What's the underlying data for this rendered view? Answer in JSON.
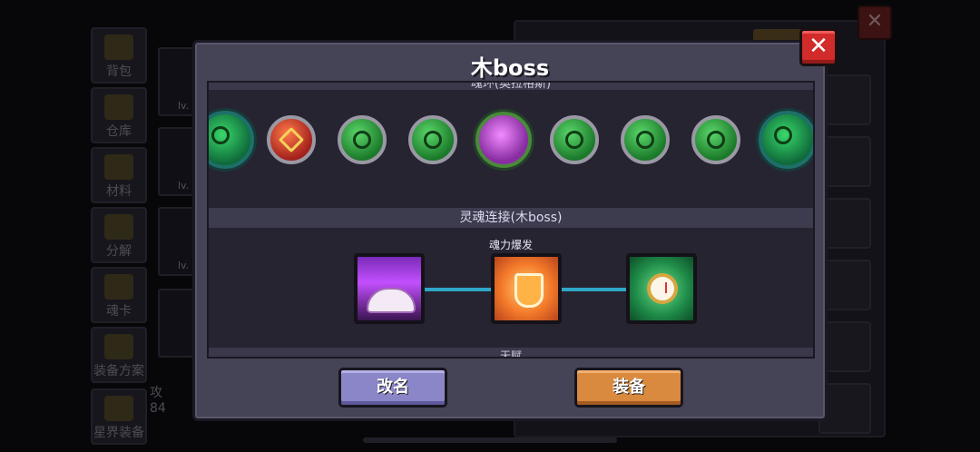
{
  "background": {
    "sidebar_items": [
      {
        "label": "背包",
        "icon": "backpack-icon"
      },
      {
        "label": "仓库",
        "icon": "warehouse-icon"
      },
      {
        "label": "材料",
        "icon": "materials-icon"
      },
      {
        "label": "分解",
        "icon": "disassemble-icon"
      },
      {
        "label": "魂卡",
        "icon": "soul-card-icon"
      },
      {
        "label": "装备方案",
        "icon": "equipment-plan-icon"
      },
      {
        "label": "星界装备",
        "icon": "astral-equipment-icon"
      }
    ],
    "card_levels": [
      "lv.",
      "lv.",
      "lv."
    ],
    "attack_label": "攻",
    "attack_value": "84"
  },
  "dialog": {
    "title": "木boss",
    "close_label": "✕",
    "top_section_partial": "魂环(奥拉格斯)",
    "souls": [
      {
        "name": "boss-soul-1",
        "kind": "boss"
      },
      {
        "name": "red-dagger-soul",
        "kind": "red"
      },
      {
        "name": "green-soul-1",
        "kind": "green"
      },
      {
        "name": "green-soul-2",
        "kind": "green"
      },
      {
        "name": "purple-orb-soul",
        "kind": "purple"
      },
      {
        "name": "green-soul-3",
        "kind": "green"
      },
      {
        "name": "green-soul-4",
        "kind": "green"
      },
      {
        "name": "green-soul-5",
        "kind": "green"
      },
      {
        "name": "boss-soul-2",
        "kind": "boss"
      }
    ],
    "soul_link_header": "灵魂连接(木boss)",
    "skill_caption": "魂力爆发",
    "skills": [
      {
        "name": "purple-book-skill",
        "icon": "spellbook-icon"
      },
      {
        "name": "orange-shield-skill",
        "icon": "shield-icon"
      },
      {
        "name": "green-watch-skill",
        "icon": "stopwatch-icon"
      }
    ],
    "bottom_section_partial": "天赋",
    "rename_label": "改名",
    "equip_label": "装备"
  },
  "colors": {
    "dialog_bg": "#454356",
    "close_red": "#d22b2b",
    "rename_purple": "#8a86c8",
    "equip_orange": "#d98a3e",
    "connector_cyan": "#2fa6c7"
  }
}
